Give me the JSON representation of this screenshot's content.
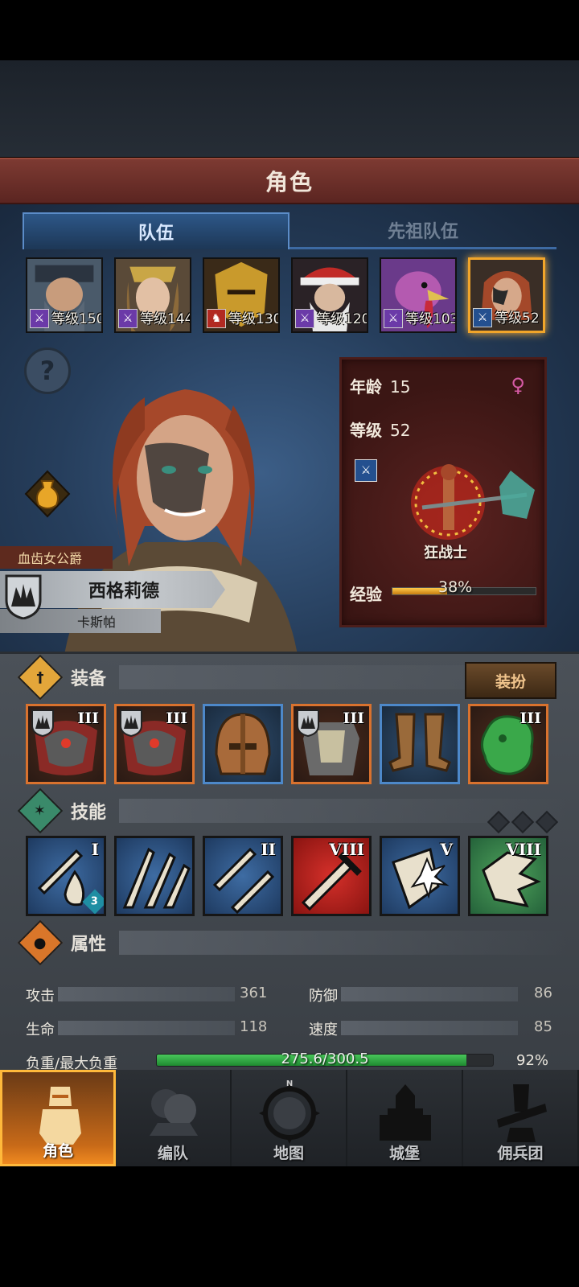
{
  "header": {
    "title": "角色"
  },
  "tabs": [
    {
      "label": "队伍"
    },
    {
      "label": "先祖队伍"
    }
  ],
  "party": [
    {
      "level_label": "等级150",
      "badge": "purple",
      "portrait": "bearded-warrior"
    },
    {
      "level_label": "等级144",
      "badge": "purple",
      "portrait": "crowned-woman"
    },
    {
      "level_label": "等级130",
      "badge": "red",
      "portrait": "golden-helm"
    },
    {
      "level_label": "等级120",
      "badge": "purple",
      "portrait": "santa-elder"
    },
    {
      "level_label": "等级103",
      "badge": "purple",
      "portrait": "turkey-head"
    },
    {
      "level_label": "等级52",
      "badge": "blue",
      "portrait": "red-haired-woman",
      "selected": true
    }
  ],
  "character": {
    "title": "血齿女公爵",
    "name": "西格莉德",
    "subname": "卡斯帕",
    "age_label": "年龄",
    "age": "15",
    "level_label": "等级",
    "level": "52",
    "gender_icon": "♀",
    "class_name": "狂战士",
    "exp_label": "经验",
    "exp_percent_text": "38%",
    "exp_fraction": 0.38
  },
  "sections": {
    "equipment": "装备",
    "dress_button": "装扮",
    "skills": "技能",
    "attributes": "属性"
  },
  "equipment": [
    {
      "name": "fur-armor-1",
      "rarity": "orange",
      "tier": "III",
      "icon": "fur-mantle-icon"
    },
    {
      "name": "fur-armor-2",
      "rarity": "orange",
      "tier": "III",
      "icon": "fur-mantle-icon"
    },
    {
      "name": "helmet",
      "rarity": "blue",
      "tier": "",
      "icon": "helmet-icon"
    },
    {
      "name": "chest",
      "rarity": "orange",
      "tier": "III",
      "icon": "armor-icon"
    },
    {
      "name": "boots",
      "rarity": "blue",
      "tier": "",
      "icon": "boots-icon"
    },
    {
      "name": "jade-charm",
      "rarity": "orange",
      "tier": "III",
      "icon": "jade-charm-icon"
    }
  ],
  "skills": [
    {
      "bg": "blue",
      "tier": "I",
      "count": "3",
      "icon": "sword-blood-icon"
    },
    {
      "bg": "blue",
      "tier": "",
      "icon": "claw-slash-icon"
    },
    {
      "bg": "blue",
      "tier": "II",
      "icon": "crossed-swords-icon"
    },
    {
      "bg": "red",
      "tier": "VIII",
      "icon": "sword-strike-icon"
    },
    {
      "bg": "blue",
      "tier": "V",
      "icon": "shield-burst-icon"
    },
    {
      "bg": "green",
      "tier": "VIII",
      "icon": "fist-icon"
    }
  ],
  "attributes": {
    "attack_label": "攻击",
    "attack": "361",
    "defense_label": "防御",
    "defense": "86",
    "hp_label": "生命",
    "hp": "118",
    "speed_label": "速度",
    "speed": "85",
    "weight_label": "负重/最大负重",
    "weight_text": "275.6/300.5",
    "weight_percent": "92%",
    "weight_fraction": 0.92
  },
  "nav": [
    {
      "label": "角色",
      "active": true,
      "icon": "knight-icon"
    },
    {
      "label": "编队",
      "icon": "formation-icon"
    },
    {
      "label": "地图",
      "icon": "compass-map-icon",
      "compass_n": "N"
    },
    {
      "label": "城堡",
      "icon": "castle-icon"
    },
    {
      "label": "佣兵团",
      "icon": "mercenary-icon"
    }
  ],
  "colors": {
    "title_bar": "#6b2e28",
    "tab_active": "#2d5788",
    "rarity_orange": "#d9722e",
    "rarity_blue": "#4d88c9",
    "exp_fill": "#f0b030",
    "weight_fill": "#36b048",
    "nav_active": "#e07a1c"
  }
}
